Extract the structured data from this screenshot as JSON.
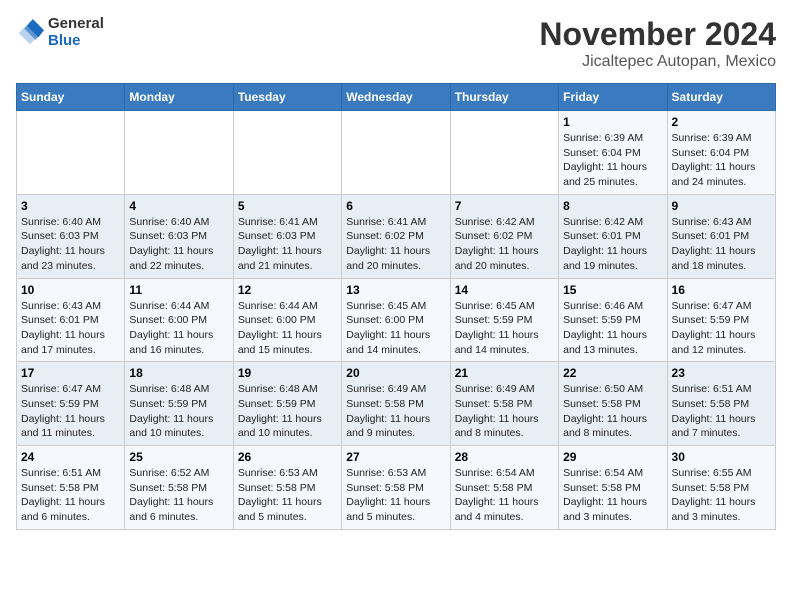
{
  "header": {
    "logo_general": "General",
    "logo_blue": "Blue",
    "title": "November 2024",
    "subtitle": "Jicaltepec Autopan, Mexico"
  },
  "weekdays": [
    "Sunday",
    "Monday",
    "Tuesday",
    "Wednesday",
    "Thursday",
    "Friday",
    "Saturday"
  ],
  "weeks": [
    [
      {
        "day": "",
        "info": ""
      },
      {
        "day": "",
        "info": ""
      },
      {
        "day": "",
        "info": ""
      },
      {
        "day": "",
        "info": ""
      },
      {
        "day": "",
        "info": ""
      },
      {
        "day": "1",
        "info": "Sunrise: 6:39 AM\nSunset: 6:04 PM\nDaylight: 11 hours and 25 minutes."
      },
      {
        "day": "2",
        "info": "Sunrise: 6:39 AM\nSunset: 6:04 PM\nDaylight: 11 hours and 24 minutes."
      }
    ],
    [
      {
        "day": "3",
        "info": "Sunrise: 6:40 AM\nSunset: 6:03 PM\nDaylight: 11 hours and 23 minutes."
      },
      {
        "day": "4",
        "info": "Sunrise: 6:40 AM\nSunset: 6:03 PM\nDaylight: 11 hours and 22 minutes."
      },
      {
        "day": "5",
        "info": "Sunrise: 6:41 AM\nSunset: 6:03 PM\nDaylight: 11 hours and 21 minutes."
      },
      {
        "day": "6",
        "info": "Sunrise: 6:41 AM\nSunset: 6:02 PM\nDaylight: 11 hours and 20 minutes."
      },
      {
        "day": "7",
        "info": "Sunrise: 6:42 AM\nSunset: 6:02 PM\nDaylight: 11 hours and 20 minutes."
      },
      {
        "day": "8",
        "info": "Sunrise: 6:42 AM\nSunset: 6:01 PM\nDaylight: 11 hours and 19 minutes."
      },
      {
        "day": "9",
        "info": "Sunrise: 6:43 AM\nSunset: 6:01 PM\nDaylight: 11 hours and 18 minutes."
      }
    ],
    [
      {
        "day": "10",
        "info": "Sunrise: 6:43 AM\nSunset: 6:01 PM\nDaylight: 11 hours and 17 minutes."
      },
      {
        "day": "11",
        "info": "Sunrise: 6:44 AM\nSunset: 6:00 PM\nDaylight: 11 hours and 16 minutes."
      },
      {
        "day": "12",
        "info": "Sunrise: 6:44 AM\nSunset: 6:00 PM\nDaylight: 11 hours and 15 minutes."
      },
      {
        "day": "13",
        "info": "Sunrise: 6:45 AM\nSunset: 6:00 PM\nDaylight: 11 hours and 14 minutes."
      },
      {
        "day": "14",
        "info": "Sunrise: 6:45 AM\nSunset: 5:59 PM\nDaylight: 11 hours and 14 minutes."
      },
      {
        "day": "15",
        "info": "Sunrise: 6:46 AM\nSunset: 5:59 PM\nDaylight: 11 hours and 13 minutes."
      },
      {
        "day": "16",
        "info": "Sunrise: 6:47 AM\nSunset: 5:59 PM\nDaylight: 11 hours and 12 minutes."
      }
    ],
    [
      {
        "day": "17",
        "info": "Sunrise: 6:47 AM\nSunset: 5:59 PM\nDaylight: 11 hours and 11 minutes."
      },
      {
        "day": "18",
        "info": "Sunrise: 6:48 AM\nSunset: 5:59 PM\nDaylight: 11 hours and 10 minutes."
      },
      {
        "day": "19",
        "info": "Sunrise: 6:48 AM\nSunset: 5:59 PM\nDaylight: 11 hours and 10 minutes."
      },
      {
        "day": "20",
        "info": "Sunrise: 6:49 AM\nSunset: 5:58 PM\nDaylight: 11 hours and 9 minutes."
      },
      {
        "day": "21",
        "info": "Sunrise: 6:49 AM\nSunset: 5:58 PM\nDaylight: 11 hours and 8 minutes."
      },
      {
        "day": "22",
        "info": "Sunrise: 6:50 AM\nSunset: 5:58 PM\nDaylight: 11 hours and 8 minutes."
      },
      {
        "day": "23",
        "info": "Sunrise: 6:51 AM\nSunset: 5:58 PM\nDaylight: 11 hours and 7 minutes."
      }
    ],
    [
      {
        "day": "24",
        "info": "Sunrise: 6:51 AM\nSunset: 5:58 PM\nDaylight: 11 hours and 6 minutes."
      },
      {
        "day": "25",
        "info": "Sunrise: 6:52 AM\nSunset: 5:58 PM\nDaylight: 11 hours and 6 minutes."
      },
      {
        "day": "26",
        "info": "Sunrise: 6:53 AM\nSunset: 5:58 PM\nDaylight: 11 hours and 5 minutes."
      },
      {
        "day": "27",
        "info": "Sunrise: 6:53 AM\nSunset: 5:58 PM\nDaylight: 11 hours and 5 minutes."
      },
      {
        "day": "28",
        "info": "Sunrise: 6:54 AM\nSunset: 5:58 PM\nDaylight: 11 hours and 4 minutes."
      },
      {
        "day": "29",
        "info": "Sunrise: 6:54 AM\nSunset: 5:58 PM\nDaylight: 11 hours and 3 minutes."
      },
      {
        "day": "30",
        "info": "Sunrise: 6:55 AM\nSunset: 5:58 PM\nDaylight: 11 hours and 3 minutes."
      }
    ]
  ]
}
